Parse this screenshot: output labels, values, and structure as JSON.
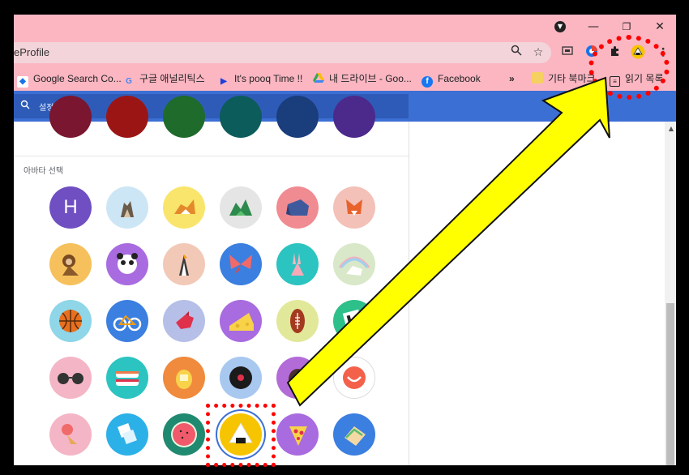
{
  "window": {
    "controls": {
      "minimize": "—",
      "restore": "❐",
      "close": "✕"
    }
  },
  "toolbar": {
    "omnibox_text": "eProfile",
    "icons": [
      "zoom-icon",
      "star-icon",
      "media-icon",
      "extension-blue-icon",
      "puzzle-icon",
      "profile-avatar-icon",
      "menu-icon"
    ]
  },
  "bookmarks": [
    {
      "label": "Google Search Co...",
      "icon": "g-icon"
    },
    {
      "label": "구글 애널리틱스",
      "icon": "google-g-icon"
    },
    {
      "label": "It's pooq Time !!",
      "icon": "play-icon"
    },
    {
      "label": "내 드라이브 - Goo...",
      "icon": "drive-icon"
    },
    {
      "label": "Facebook",
      "icon": "facebook-icon"
    },
    {
      "label": "»",
      "icon": ""
    },
    {
      "label": "기타 북마크",
      "icon": "folder-icon"
    },
    {
      "label": "읽기 목록",
      "icon": "reading-list-icon"
    }
  ],
  "settings": {
    "search_placeholder": "설정 검색",
    "section_label": "아바타 선택",
    "first_avatar_letter": "H"
  },
  "colors": {
    "titlebar": "#fbb6c2",
    "header_blue": "#3b6fd4",
    "annotation_red": "#ff0000",
    "arrow_yellow": "#ffff00"
  },
  "avatar_names": [
    [
      "avatar-h",
      "avatar-cat",
      "avatar-corgi",
      "avatar-dragon",
      "avatar-elephant",
      "avatar-fox"
    ],
    [
      "avatar-monkey",
      "avatar-panda",
      "avatar-penguin",
      "avatar-butterfly",
      "avatar-rabbit",
      "avatar-unicorn"
    ],
    [
      "avatar-basketball",
      "avatar-bicycle",
      "avatar-bird",
      "avatar-cheese",
      "avatar-football",
      "avatar-ruler"
    ],
    [
      "avatar-sunglasses",
      "avatar-sushi",
      "avatar-tamagotchi",
      "avatar-vinyl",
      "avatar-avocado",
      "avatar-smile"
    ],
    [
      "avatar-icecream",
      "avatar-note",
      "avatar-watermelon",
      "avatar-onigiri",
      "avatar-pizza",
      "avatar-sandwich"
    ]
  ]
}
